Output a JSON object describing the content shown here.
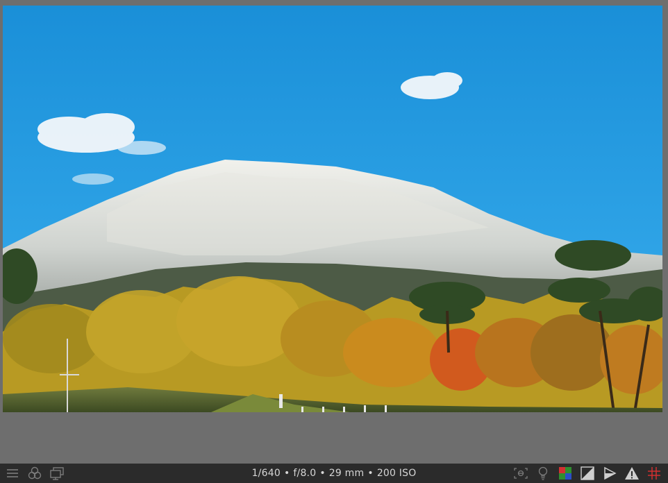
{
  "image": {
    "description_icon": "photo-preview"
  },
  "exif": {
    "shutter": "1/640",
    "aperture": "f/8.0",
    "focal_length": "29 mm",
    "iso": "200 ISO",
    "separator": "•"
  },
  "toolbar_left": {
    "icons": [
      "menu-icon",
      "styles-icon",
      "second-window-icon"
    ]
  },
  "toolbar_right": {
    "icons": [
      "focus-peaking-icon",
      "color-assessment-icon",
      "softproof-icon",
      "gamut-check-icon",
      "raw-overexposed-icon",
      "clipping-warning-icon",
      "guides-icon"
    ]
  },
  "colors": {
    "background": "#6e6e6e",
    "bar": "#2b2b2b",
    "text": "#d6d6d6"
  }
}
